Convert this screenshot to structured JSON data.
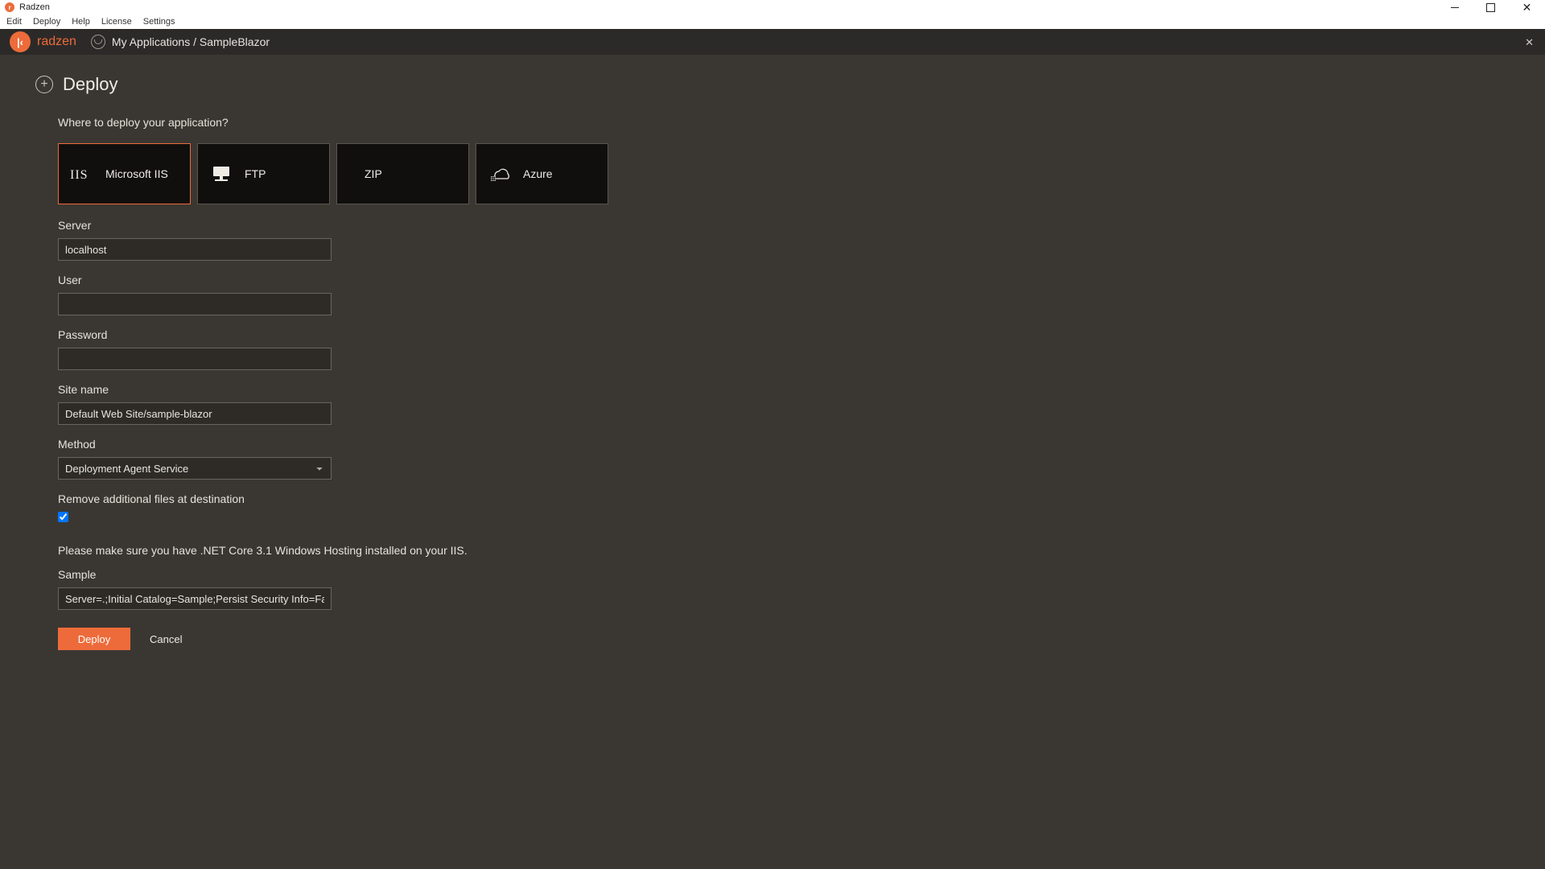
{
  "window": {
    "title": "Radzen"
  },
  "menu": {
    "items": [
      "Edit",
      "Deploy",
      "Help",
      "License",
      "Settings"
    ]
  },
  "header": {
    "brand": "radzen",
    "breadcrumb": "My Applications / SampleBlazor"
  },
  "page": {
    "title": "Deploy",
    "subhead": "Where to deploy your application?",
    "targets": [
      {
        "label": "Microsoft IIS",
        "icon": "iis-icon",
        "selected": true
      },
      {
        "label": "FTP",
        "icon": "ftp-icon",
        "selected": false
      },
      {
        "label": "ZIP",
        "icon": "zip-icon",
        "selected": false
      },
      {
        "label": "Azure",
        "icon": "azure-icon",
        "selected": false
      }
    ],
    "form": {
      "server": {
        "label": "Server",
        "value": "localhost"
      },
      "user": {
        "label": "User",
        "value": ""
      },
      "password": {
        "label": "Password",
        "value": ""
      },
      "sitename": {
        "label": "Site name",
        "value": "Default Web Site/sample-blazor"
      },
      "method": {
        "label": "Method",
        "value": "Deployment Agent Service"
      },
      "remove": {
        "label": "Remove additional files at destination",
        "checked": true
      },
      "notice": "Please make sure you have .NET Core 3.1 Windows Hosting installed on your IIS.",
      "sample": {
        "label": "Sample",
        "value": "Server=.;Initial Catalog=Sample;Persist Security Info=False;Integrated Security=True"
      }
    },
    "actions": {
      "primary": "Deploy",
      "secondary": "Cancel"
    }
  }
}
